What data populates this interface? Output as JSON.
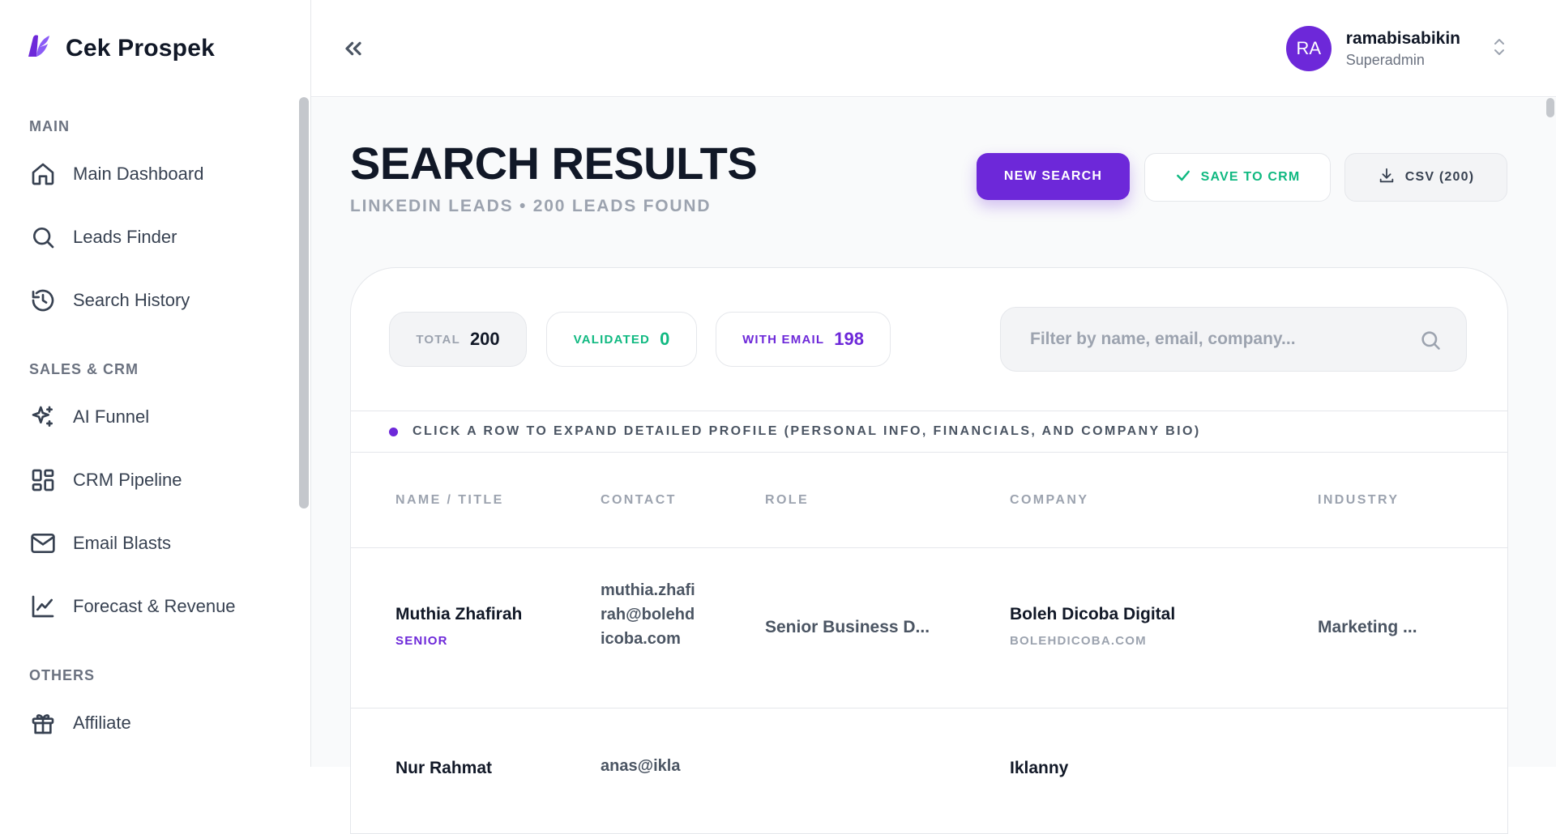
{
  "brand": {
    "name": "Cek Prospek",
    "logo_icon": "leaf-logo-icon",
    "accent": "#6d28d9"
  },
  "sidebar": {
    "sections": [
      {
        "title": "MAIN",
        "items": [
          {
            "label": "Main Dashboard",
            "icon": "home-icon"
          },
          {
            "label": "Leads Finder",
            "icon": "search-icon"
          },
          {
            "label": "Search History",
            "icon": "history-icon"
          }
        ]
      },
      {
        "title": "SALES & CRM",
        "items": [
          {
            "label": "AI Funnel",
            "icon": "sparkles-icon"
          },
          {
            "label": "CRM Pipeline",
            "icon": "layout-icon"
          },
          {
            "label": "Email Blasts",
            "icon": "mail-icon"
          },
          {
            "label": "Forecast & Revenue",
            "icon": "chart-line-icon"
          }
        ]
      },
      {
        "title": "OTHERS",
        "items": [
          {
            "label": "Affiliate",
            "icon": "gift-icon"
          }
        ]
      }
    ]
  },
  "topbar": {
    "collapse_icon": "chevrons-left-icon",
    "user": {
      "initials": "RA",
      "name": "ramabisabikin",
      "role": "Superadmin"
    }
  },
  "page": {
    "title": "SEARCH RESULTS",
    "subtitle": "LINKEDIN LEADS • 200 LEADS FOUND",
    "buttons": {
      "new_search": "NEW SEARCH",
      "save_crm": "SAVE TO CRM",
      "csv": "CSV (200)"
    }
  },
  "stats": {
    "total": {
      "label": "TOTAL",
      "value": "200"
    },
    "validated": {
      "label": "VALIDATED",
      "value": "0"
    },
    "with_email": {
      "label": "WITH EMAIL",
      "value": "198"
    }
  },
  "filter": {
    "placeholder": "Filter by name, email, company..."
  },
  "hint": "CLICK A ROW TO EXPAND DETAILED PROFILE (PERSONAL INFO, FINANCIALS, AND COMPANY BIO)",
  "table": {
    "columns": [
      "NAME / TITLE",
      "CONTACT",
      "ROLE",
      "COMPANY",
      "INDUSTRY"
    ],
    "rows": [
      {
        "name": "Muthia Zhafirah",
        "seniority": "SENIOR",
        "email": "muthia.zhafirah@bolehdicoba.com",
        "role": "Senior Business D...",
        "company": "Boleh Dicoba Digital",
        "domain": "BOLEHDICOBA.COM",
        "industry": "Marketing ..."
      },
      {
        "name": "Nur Rahmat",
        "seniority": "",
        "email": "anas@ikla",
        "role": "",
        "company": "Iklanny",
        "domain": "",
        "industry": ""
      }
    ]
  }
}
